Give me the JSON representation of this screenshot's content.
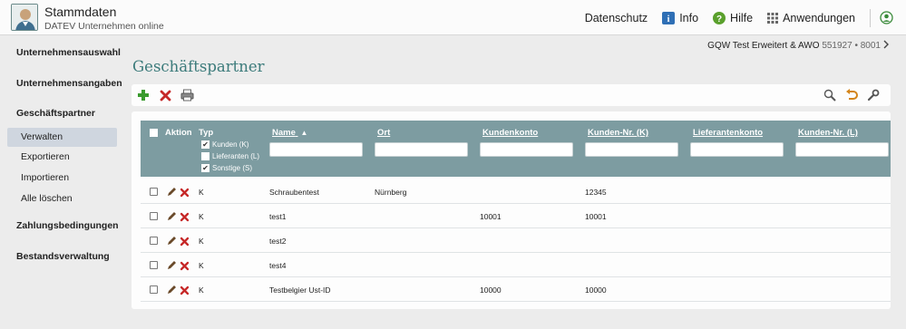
{
  "header": {
    "title": "Stammdaten",
    "subtitle": "DATEV Unternehmen online",
    "nav": {
      "datenschutz": "Datenschutz",
      "info": "Info",
      "hilfe": "Hilfe",
      "anwendungen": "Anwendungen"
    }
  },
  "sidebar": {
    "sections": [
      {
        "label": "Unternehmensauswahl"
      },
      {
        "label": "Unternehmensangaben"
      },
      {
        "label": "Geschäftspartner"
      },
      {
        "label": "Zahlungsbedingungen"
      },
      {
        "label": "Bestandsverwaltung"
      }
    ],
    "subitems": [
      {
        "label": "Verwalten",
        "active": true
      },
      {
        "label": "Exportieren"
      },
      {
        "label": "Importieren"
      },
      {
        "label": "Alle löschen"
      }
    ]
  },
  "company": {
    "name": "GQW Test Erweitert & AWO",
    "numbers": "551927 • 8001"
  },
  "page": {
    "title": "Geschäftspartner"
  },
  "toolbar": {
    "icons": [
      "add-icon",
      "delete-icon",
      "print-icon",
      "search-icon",
      "undo-icon",
      "settings-wrench-icon"
    ]
  },
  "table": {
    "headers": {
      "aktion": "Aktion",
      "typ": "Typ",
      "name": "Name",
      "ort": "Ort",
      "kundenkonto": "Kundenkonto",
      "kunden_nr": "Kunden-Nr. (K)",
      "lieferantenkonto": "Lieferantenkonto",
      "kunden_nr_l": "Kunden-Nr. (L)"
    },
    "typ_filters": [
      {
        "label": "Kunden (K)",
        "checked": true
      },
      {
        "label": "Lieferanten (L)",
        "checked": false
      },
      {
        "label": "Sonstige (S)",
        "checked": true
      }
    ],
    "rows": [
      {
        "typ": "K",
        "name": "Schraubentest",
        "ort": "Nürnberg",
        "kundenkonto": "",
        "kunden_nr": "12345"
      },
      {
        "typ": "K",
        "name": "test1",
        "ort": "",
        "kundenkonto": "10001",
        "kunden_nr": "10001"
      },
      {
        "typ": "K",
        "name": "test2",
        "ort": "",
        "kundenkonto": "",
        "kunden_nr": ""
      },
      {
        "typ": "K",
        "name": "test4",
        "ort": "",
        "kundenkonto": "",
        "kunden_nr": ""
      },
      {
        "typ": "K",
        "name": "Testbelgier Ust-ID",
        "ort": "",
        "kundenkonto": "10000",
        "kunden_nr": "10000"
      }
    ]
  },
  "colors": {
    "accent": "#3c7b7b",
    "grid_header": "#7d9ca1",
    "active_nav": "#cfd6df",
    "delete_red": "#c62828",
    "add_green": "#3a9b2e"
  }
}
